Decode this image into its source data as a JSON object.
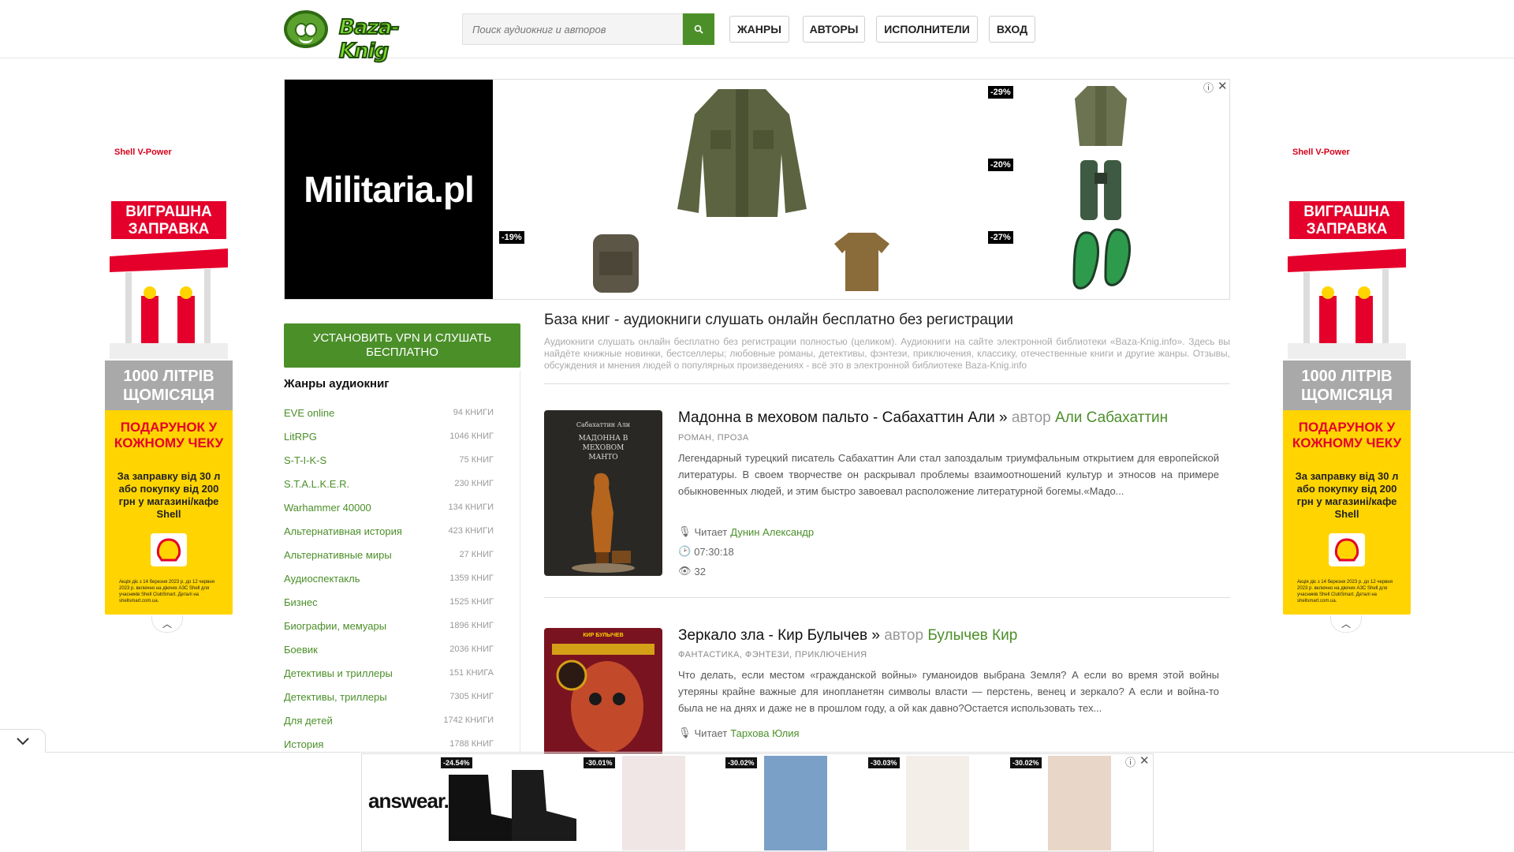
{
  "header": {
    "logo_text": "Baza-Knig",
    "search_placeholder": "Поиск аудиокниг и авторов",
    "nav": [
      "ЖАНРЫ",
      "АВТОРЫ",
      "ИСПОЛНИТЕЛИ",
      "ВХОД"
    ]
  },
  "ads": {
    "top_brand": "Militaria.pl",
    "top_discounts": [
      "-29%",
      "-20%",
      "-19%",
      "-27%"
    ],
    "side_brand": "Shell V-Power",
    "side_headline": "ВИГРАШНА ЗАПРАВКА",
    "side_promo": "1000 ЛІТРІВ ЩОМІСЯЦЯ",
    "side_gift": "ПОДАРУНОК У КОЖНОМУ ЧЕКУ",
    "side_text": "За заправку від 30 л або покупку від 200 грн у магазині/кафе Shell",
    "side_fine": "Акція діє з 14 березня 2023 р. до 12 червня 2023 р. включно на діючих АЗС Shell для учасників Shell ClubSmart. Деталі на shellsmart.com.ua.",
    "bottom_brand": "answear.",
    "bottom_discounts": [
      "-24.54%",
      "-30.01%",
      "-30.02%",
      "-30.03%",
      "-30.02%"
    ]
  },
  "sidebar": {
    "vpn_button": "УСТАНОВИТЬ VPN И СЛУШАТЬ БЕСПЛАТНО",
    "genres_title": "Жанры аудиокниг",
    "genres": [
      {
        "name": "EVE online",
        "count": "94 книги"
      },
      {
        "name": "LitRPG",
        "count": "1046 книг"
      },
      {
        "name": "S-T-I-K-S",
        "count": "75 книг"
      },
      {
        "name": "S.T.A.L.K.E.R.",
        "count": "230 книг"
      },
      {
        "name": "Warhammer 40000",
        "count": "134 книги"
      },
      {
        "name": "Альтернативная история",
        "count": "423 книги"
      },
      {
        "name": "Альтернативные миры",
        "count": "27 книг"
      },
      {
        "name": "Аудиоспектакль",
        "count": "1359 книг"
      },
      {
        "name": "Бизнес",
        "count": "1525 книг"
      },
      {
        "name": "Биографии, мемуары",
        "count": "1896 книг"
      },
      {
        "name": "Боевик",
        "count": "2036 книг"
      },
      {
        "name": "Детективы и триллеры",
        "count": "151 книга"
      },
      {
        "name": "Детективы, триллеры",
        "count": "7305 книг"
      },
      {
        "name": "Для детей",
        "count": "1742 книги"
      },
      {
        "name": "История",
        "count": "1788 книг"
      }
    ]
  },
  "main": {
    "title": "База книг - аудиокниги слушать онлайн бесплатно без регистрации",
    "description": "Аудиокниги слушать онлайн бесплатно без регистрации полностью (целиком). Аудиокниги на сайте электронной библиотеки «Baza-Knig.info». Здесь вы найдёте книжные новинки, бестселлеры; любовные романы, детективы, фэнтези, приключения, классику, отечественные книги и другие жанры. Отзывы, обсуждения и мнения людей о популярных произведениях - всё это в электронной библиотеке Baza-Knig.info",
    "books": [
      {
        "title": "Мадонна в меховом пальто - Сабахаттин Али »",
        "author_prefix": "автор",
        "author": "Али Сабахаттин",
        "tags": "РОМАН, ПРОЗА",
        "description": "Легендарный турецкий писатель Сабахаттин Али стал запоздалым триумфальным открытием для европейской литературы. В своем творчестве он раскрывал проблемы взаимоотношений культур и этносов на примере обыкновенных людей, и этим быстро завоевал расположение литературной богемы.«Мадо...",
        "reader_prefix": "Читает",
        "reader": "Дунин Александр",
        "duration": "07:30:18",
        "views": "32",
        "cover_author": "Сабахаттин Али",
        "cover_title": "МАДОННА В МЕХОВОМ МАНТО"
      },
      {
        "title": "Зеркало зла - Кир Булычев »",
        "author_prefix": "автор",
        "author": "Булычев Кир",
        "tags": "ФАНТАСТИКА, ФЭНТЕЗИ, ПРИКЛЮЧЕНИЯ",
        "description": "Что делать, если местом «гражданской войны» гуманоидов выбрана Земля? А если во время этой войны утеряны крайне важные для инопланетян символы власти — перстень, венец и зеркало? А если и война-то была не на днях и даже не в прошлом году, а ой как давно?Остается использовать тех...",
        "reader_prefix": "Читает",
        "reader": "Тархова Юлия",
        "cover_author": "КИР БУЛЫЧЕВ"
      }
    ]
  }
}
